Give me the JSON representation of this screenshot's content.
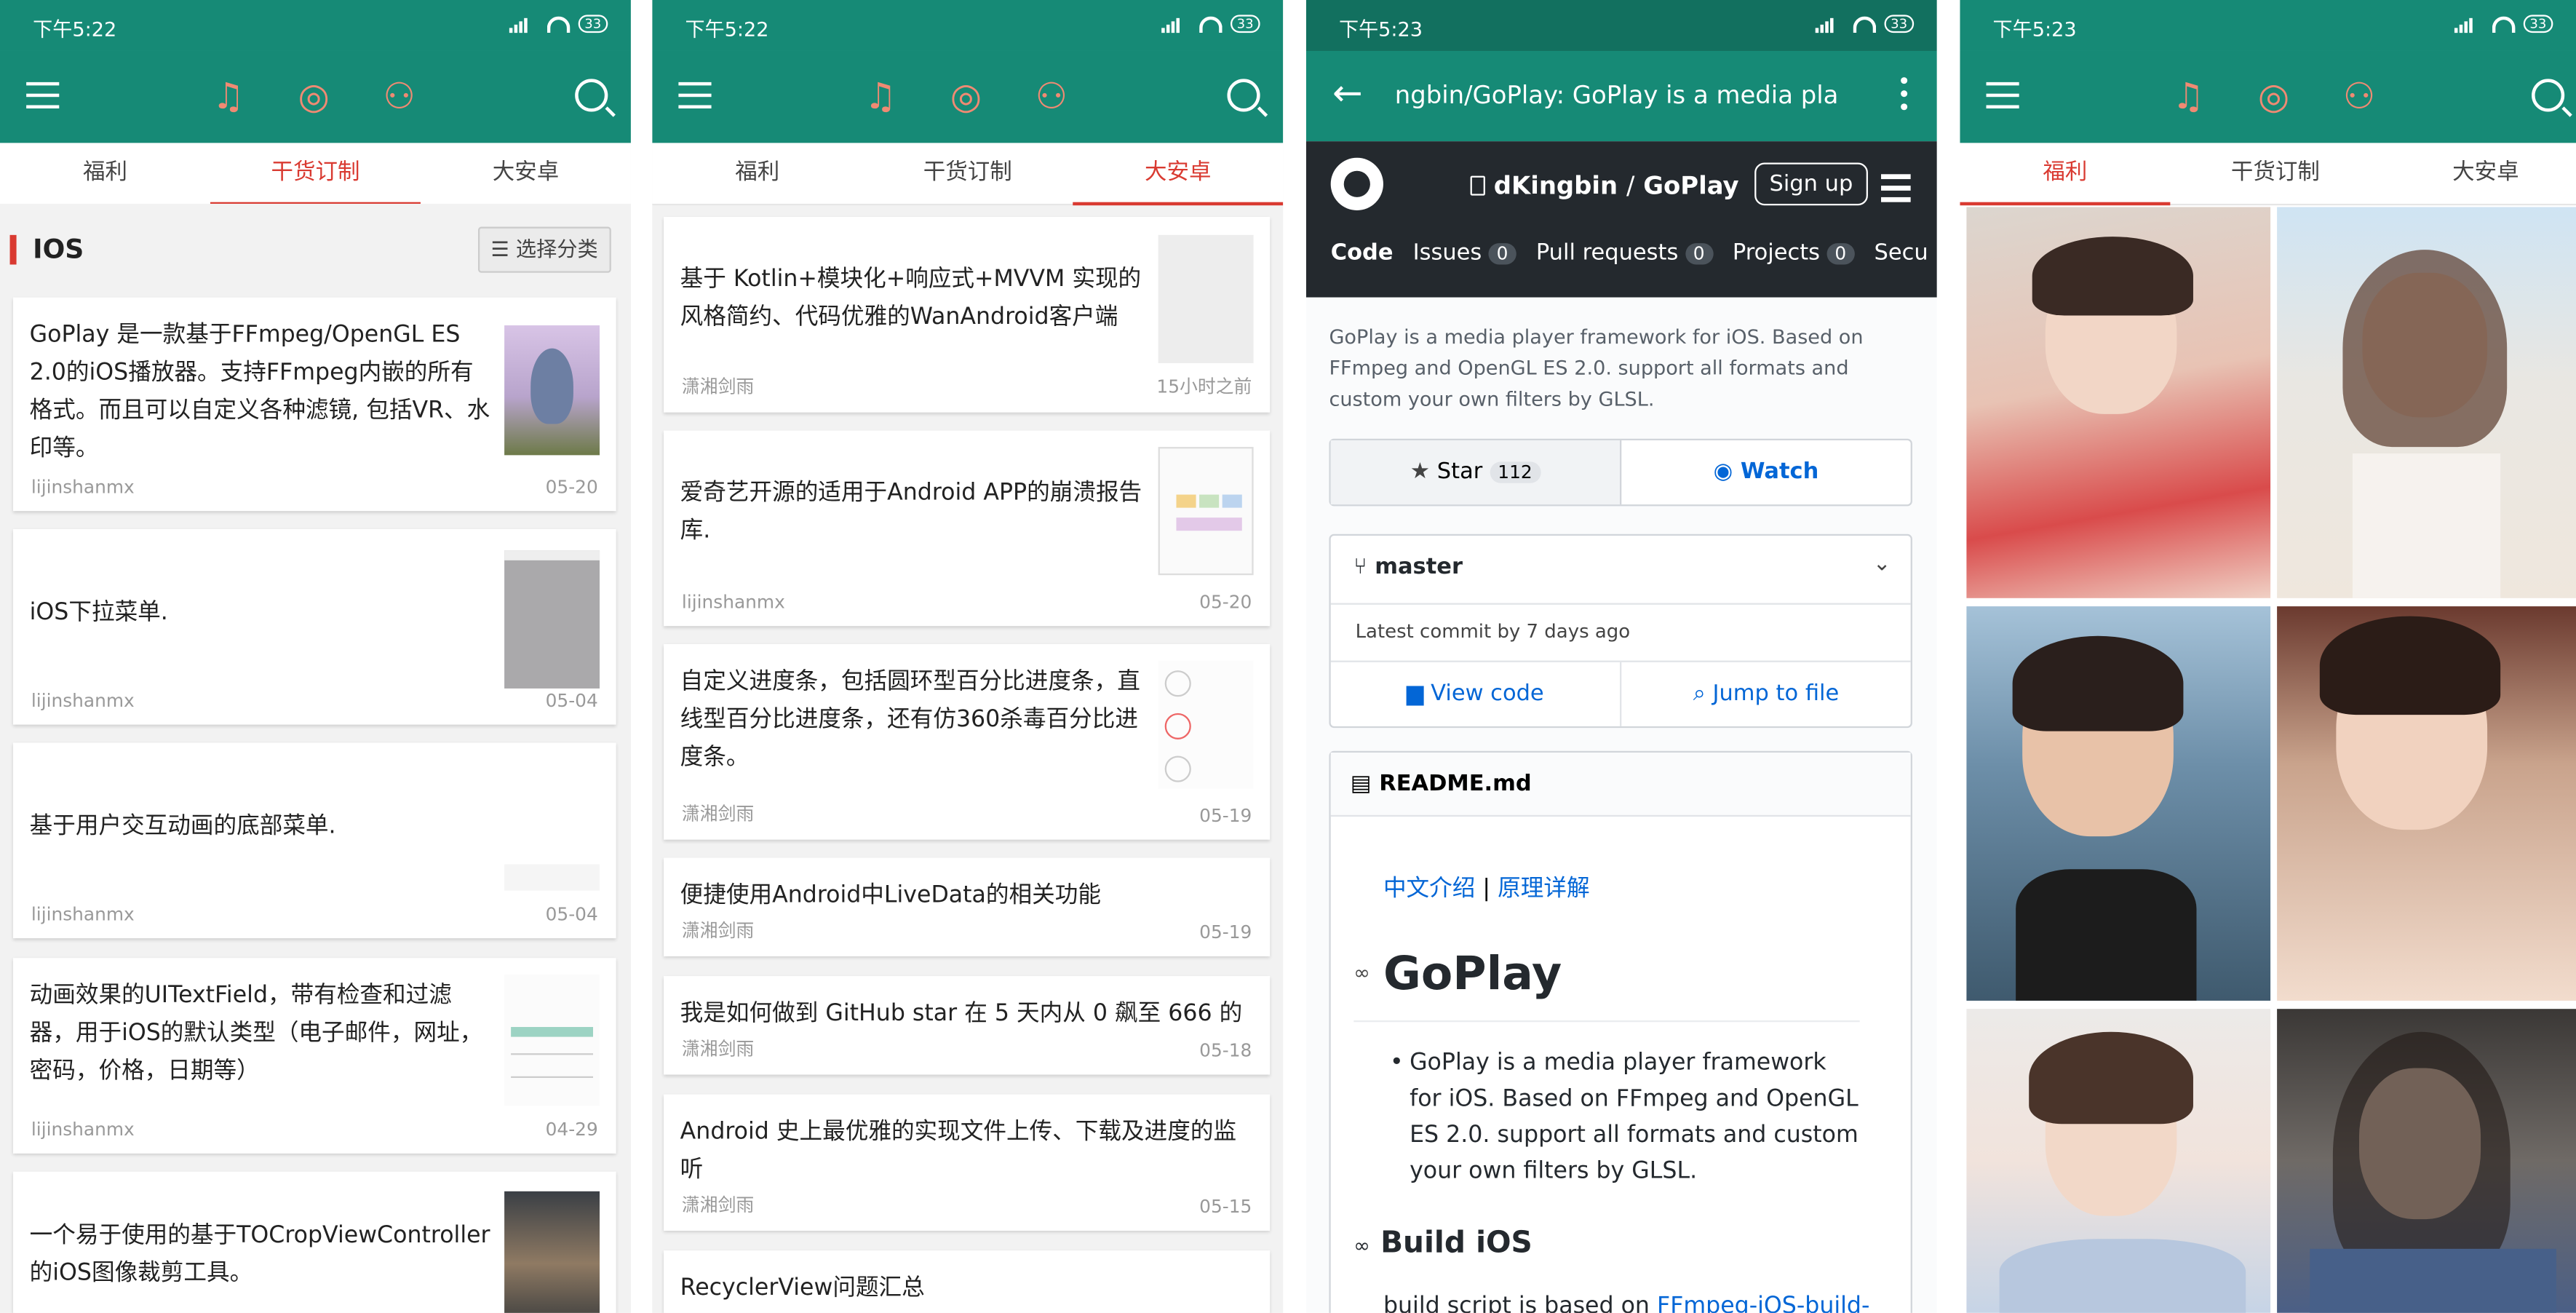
{
  "status": {
    "time_a": "下午5:22",
    "time_b": "下午5:23",
    "battery": "33"
  },
  "tabs": {
    "fuli": "福利",
    "ganhuo": "干货订制",
    "android": "大安卓"
  },
  "ios_section": {
    "title": "IOS",
    "category_button": "选择分类"
  },
  "ios_list": [
    {
      "text": "GoPlay 是一款基于FFmpeg/OpenGL ES 2.0的iOS播放器。支持FFmpeg内嵌的所有格式。而且可以自定义各种滤镜, 包括VR、水印等。",
      "author": "lijinshanmx",
      "date": "05-20"
    },
    {
      "text": "iOS下拉菜单.",
      "author": "lijinshanmx",
      "date": "05-04"
    },
    {
      "text": "基于用户交互动画的底部菜单.",
      "author": "lijinshanmx",
      "date": "05-04"
    },
    {
      "text": "动画效果的UITextField，带有检查和过滤器，用于iOS的默认类型（电子邮件，网址，密码，价格，日期等）",
      "author": "lijinshanmx",
      "date": "04-29"
    },
    {
      "text": "一个易于使用的基于TOCropViewController的iOS图像裁剪工具。",
      "author": "",
      "date": ""
    }
  ],
  "android_list": [
    {
      "text": "基于 Kotlin+模块化+响应式+MVVM 实现的风格简约、代码优雅的WanAndroid客户端",
      "author": "潇湘剑雨",
      "date": "15小时之前"
    },
    {
      "text": "爱奇艺开源的适用于Android APP的崩溃报告库.",
      "author": "lijinshanmx",
      "date": "05-20"
    },
    {
      "text": "自定义进度条，包括圆环型百分比进度条，直线型百分比进度条，还有仿360杀毒百分比进度条。",
      "author": "潇湘剑雨",
      "date": "05-19"
    },
    {
      "text": "便捷使用Android中LiveData的相关功能",
      "author": "潇湘剑雨",
      "date": "05-19"
    },
    {
      "text": "我是如何做到 GitHub star 在 5 天内从 0 飙至 666 的",
      "author": "潇湘剑雨",
      "date": "05-18"
    },
    {
      "text": "Android 史上最优雅的实现文件上传、下载及进度的监听",
      "author": "潇湘剑雨",
      "date": "05-15"
    },
    {
      "text": "RecyclerView问题汇总",
      "author": "",
      "date": ""
    }
  ],
  "github": {
    "url_title": "ngbin/GoPlay: GoPlay is a media pla",
    "owner": "dKingbin",
    "sep": "/",
    "repo": "GoPlay",
    "signup": "Sign up",
    "nav": {
      "code": "Code",
      "issues": "Issues",
      "issues_count": "0",
      "pulls": "Pull requests",
      "pulls_count": "0",
      "projects": "Projects",
      "projects_count": "0",
      "security": "Secu"
    },
    "description": "GoPlay is a media player framework for iOS. Based on FFmpeg and OpenGL ES 2.0. support all formats and custom your own filters by GLSL.",
    "star": "Star",
    "star_count": "112",
    "watch": "Watch",
    "branch": "master",
    "latest_commit": "Latest commit by 7 days ago",
    "view_code": "View code",
    "jump_to_file": "Jump to file",
    "readme": "README.md",
    "intro_link": "中文介绍",
    "pipe": "|",
    "detail_link": "原理详解",
    "h1": "GoPlay",
    "bullet": "GoPlay is a media player framework for iOS. Based on FFmpeg and OpenGL ES 2.0. support all formats and custom your own filters by GLSL.",
    "h2": "Build iOS",
    "build_text": "build script is based on",
    "build_link": "FFmpeg-iOS-build-"
  },
  "colors": {
    "teal": "#168a76",
    "accent_red": "#d93a31",
    "github_dark": "#24292e",
    "link_blue": "#0366d6"
  }
}
